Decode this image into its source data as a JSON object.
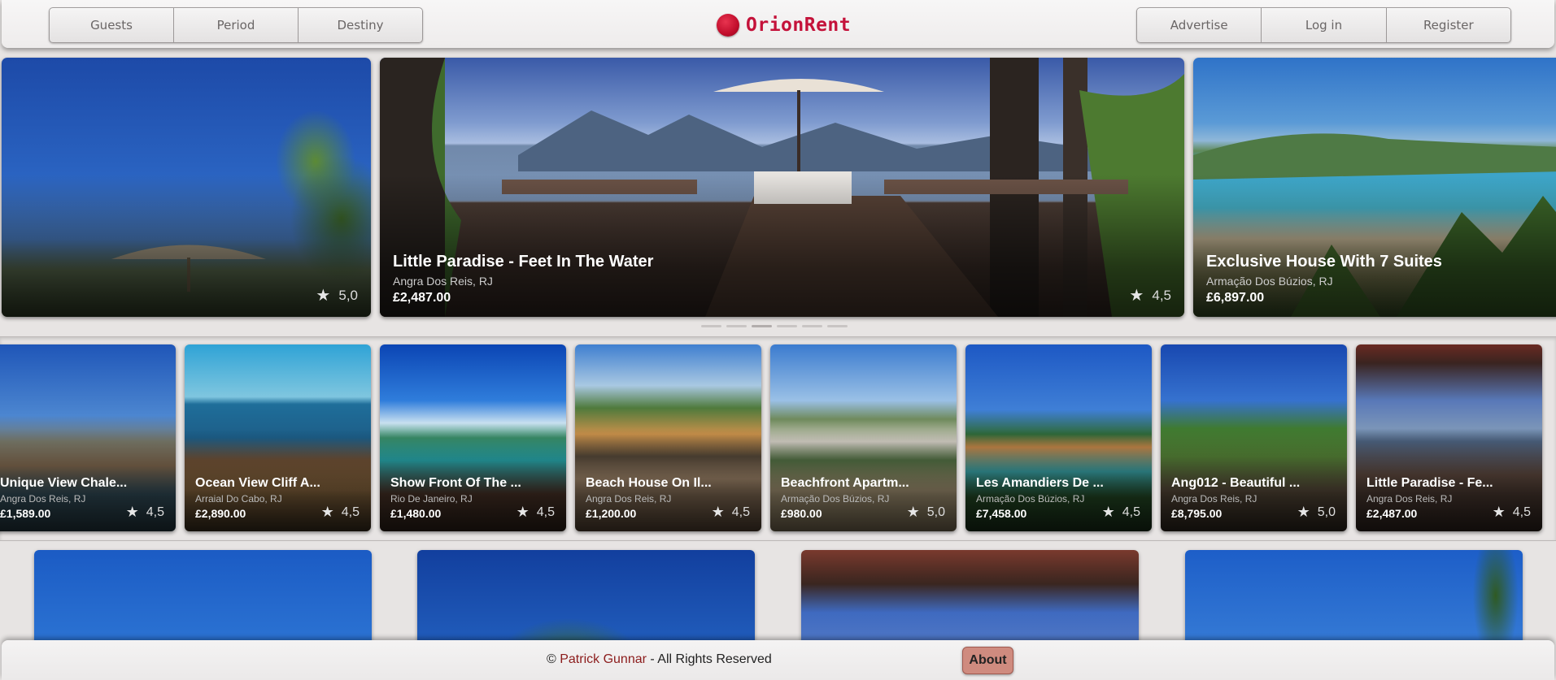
{
  "header": {
    "nav_left": [
      "Guests",
      "Period",
      "Destiny"
    ],
    "brand": "OrionRent",
    "nav_right": [
      "Advertise",
      "Log in",
      "Register"
    ]
  },
  "hero": [
    {
      "title": "",
      "location": "",
      "price": "",
      "rating": "5,0"
    },
    {
      "title": "Little Paradise - Feet In The Water",
      "location": "Angra Dos Reis, RJ",
      "price": "£2,487.00",
      "rating": "4,5"
    },
    {
      "title": "Exclusive House With 7 Suites",
      "location": "Armação Dos Búzios, RJ",
      "price": "£6,897.00",
      "rating": ""
    }
  ],
  "carousel_dots": 6,
  "carousel_active_dot": 3,
  "listings": [
    {
      "title": "Unique View Chale...",
      "location": "Angra Dos Reis, RJ",
      "price": "£1,589.00",
      "rating": "4,5"
    },
    {
      "title": "Ocean View Cliff A...",
      "location": "Arraial Do Cabo, RJ",
      "price": "£2,890.00",
      "rating": "4,5"
    },
    {
      "title": "Show Front Of The ...",
      "location": "Rio De Janeiro, RJ",
      "price": "£1,480.00",
      "rating": "4,5"
    },
    {
      "title": "Beach House On Il...",
      "location": "Angra Dos Reis, RJ",
      "price": "£1,200.00",
      "rating": "4,5"
    },
    {
      "title": "Beachfront Apartm...",
      "location": "Armação Dos Búzios, RJ",
      "price": "£980.00",
      "rating": "5,0"
    },
    {
      "title": "Les Amandiers De ...",
      "location": "Armação Dos Búzios, RJ",
      "price": "£7,458.00",
      "rating": "4,5"
    },
    {
      "title": "Ang012 - Beautiful ...",
      "location": "Angra Dos Reis, RJ",
      "price": "£8,795.00",
      "rating": "5,0"
    },
    {
      "title": "Little Paradise - Fe...",
      "location": "Angra Dos Reis, RJ",
      "price": "£2,487.00",
      "rating": "4,5"
    }
  ],
  "footer": {
    "copyright_prefix": "© ",
    "author": "Patrick Gunnar",
    "copyright_suffix": " - All Rights Reserved",
    "about_label": "About"
  },
  "colors": {
    "brand": "#c4123a",
    "about_button": "#cf8b7f",
    "author_link": "#8c1c1c"
  },
  "icons": [
    "orion-logo-icon",
    "star-icon"
  ]
}
